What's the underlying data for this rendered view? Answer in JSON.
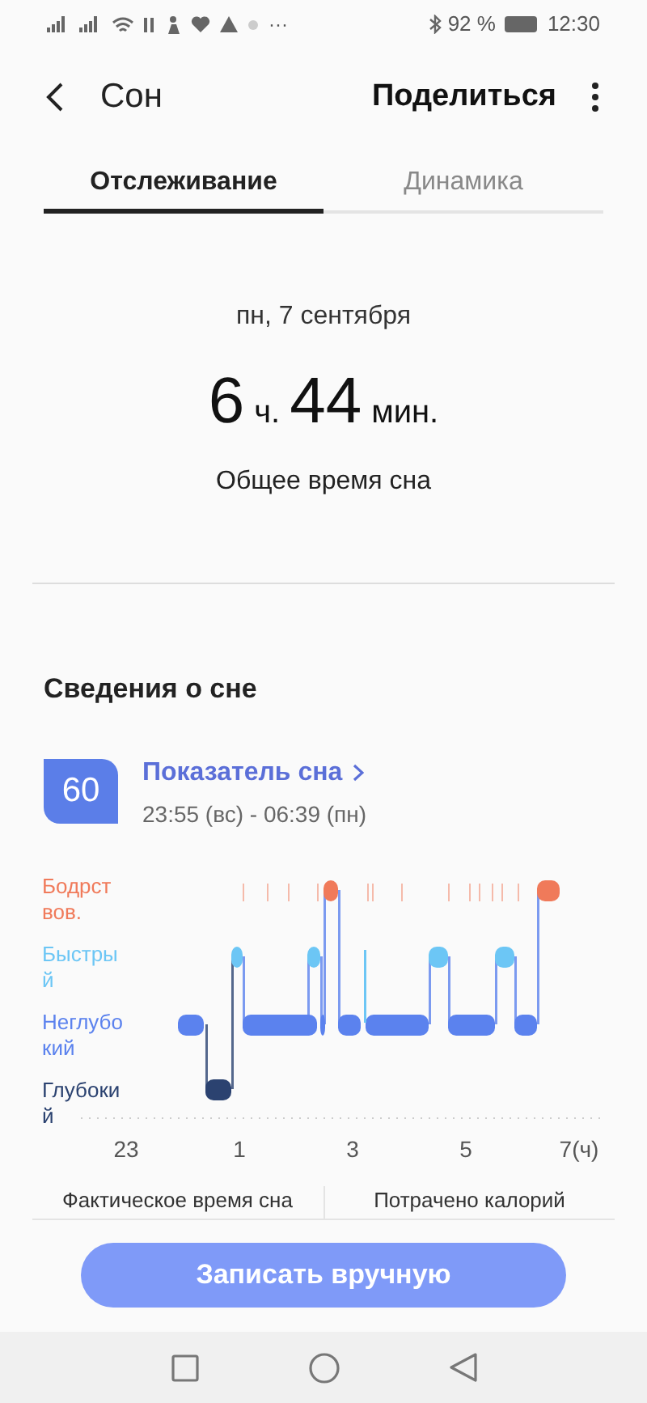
{
  "status_bar": {
    "more": "···",
    "battery": "92 %",
    "time": "12:30"
  },
  "header": {
    "title": "Сон",
    "action": "Поделиться"
  },
  "tabs": [
    {
      "label": "Отслеживание",
      "selected": true
    },
    {
      "label": "Динамика",
      "selected": false
    }
  ],
  "summary": {
    "date": "пн, 7 сентября",
    "hours": "6",
    "hours_unit": "ч.",
    "minutes": "44",
    "minutes_unit": "мин.",
    "caption": "Общее время сна"
  },
  "details": {
    "title": "Сведения о сне",
    "score": "60",
    "score_link": "Показатель сна",
    "range": "23:55 (вс) - 06:39 (пн)",
    "stages": [
      {
        "label": "Бодрст вов.",
        "color": "#f07a5a"
      },
      {
        "label": "Быстры й",
        "color": "#6cc6f5"
      },
      {
        "label": "Неглубо кий",
        "color": "#5b82ee"
      },
      {
        "label": "Глубоки й",
        "color": "#2b4270"
      }
    ],
    "x_ticks": [
      "23",
      "1",
      "3",
      "5",
      "7(ч)"
    ],
    "stats": [
      "Фактическое время сна",
      "Потрачено калорий"
    ]
  },
  "button": "Записать вручную"
}
